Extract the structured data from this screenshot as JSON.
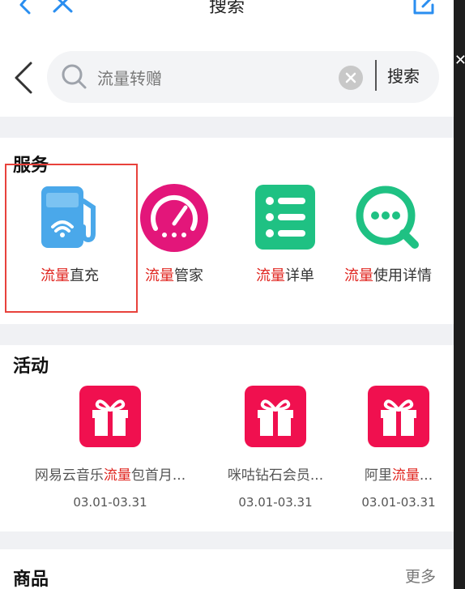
{
  "nav": {
    "title": "搜索"
  },
  "search": {
    "query": "流量转赠",
    "button": "搜索"
  },
  "services": {
    "title": "服务",
    "items": [
      {
        "hl": "流量",
        "rest": "直充",
        "icon": "fuel-pump-wifi-icon",
        "color": "#4aa8ea"
      },
      {
        "hl": "流量",
        "rest": "管家",
        "icon": "speedometer-icon",
        "color": "#e3167a"
      },
      {
        "hl": "流量",
        "rest": "详单",
        "icon": "list-icon",
        "color": "#1fc183"
      },
      {
        "hl": "流量",
        "rest": "使用详情",
        "icon": "chat-search-icon",
        "color": "#1fc183"
      }
    ]
  },
  "activities": {
    "title": "活动",
    "items": [
      {
        "pre": "网易云音乐",
        "hl": "流量",
        "post": "包首月...",
        "date": "03.01-03.31"
      },
      {
        "pre": "咪咕钻石会员...",
        "hl": "",
        "post": "",
        "date": "03.01-03.31"
      },
      {
        "pre": "阿里",
        "hl": "流量",
        "post": "...",
        "date": "03.01-03.31"
      }
    ]
  },
  "goods": {
    "title": "商品",
    "more": "更多"
  },
  "colors": {
    "highlight": "#e0251f",
    "gift": "#f0104f",
    "box": "#e8423c"
  }
}
